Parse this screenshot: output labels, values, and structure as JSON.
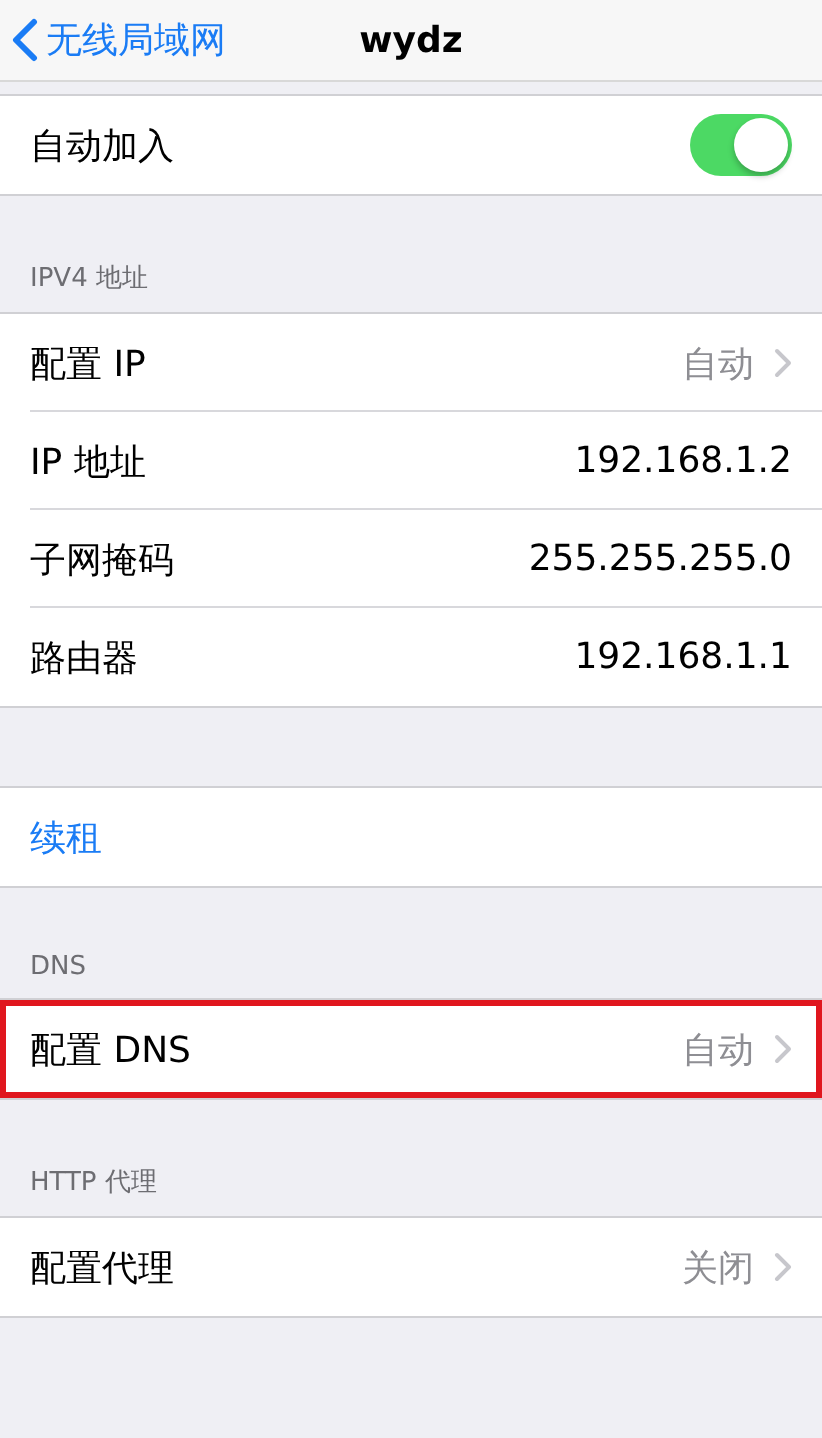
{
  "nav": {
    "back": "无线局域网",
    "title": "wydz"
  },
  "sections": [
    {
      "rows": [
        {
          "kind": "toggle",
          "label": "自动加入",
          "on": true
        }
      ]
    },
    {
      "header": "IPV4 地址",
      "rows": [
        {
          "kind": "link",
          "label": "配置 IP",
          "value": "自动",
          "highlighted": false
        },
        {
          "kind": "value",
          "label": "IP 地址",
          "value": "192.168.1.2"
        },
        {
          "kind": "value",
          "label": "子网掩码",
          "value": "255.255.255.0"
        },
        {
          "kind": "value",
          "label": "路由器",
          "value": "192.168.1.1"
        }
      ]
    },
    {
      "rows": [
        {
          "kind": "action",
          "label": "续租"
        }
      ]
    },
    {
      "header": "DNS",
      "rows": [
        {
          "kind": "link",
          "label": "配置 DNS",
          "value": "自动",
          "highlighted": true
        }
      ]
    },
    {
      "header": "HTTP 代理",
      "rows": [
        {
          "kind": "link",
          "label": "配置代理",
          "value": "关闭",
          "highlighted": false
        }
      ]
    }
  ]
}
